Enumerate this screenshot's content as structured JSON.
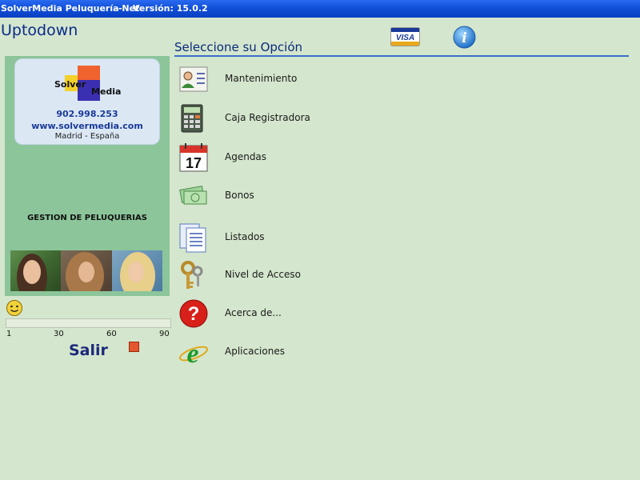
{
  "window": {
    "app_title": "SolverMedia Peluquería Net",
    "separator": "-",
    "version": "Versión: 15.0.2"
  },
  "brand": "Uptodown",
  "header": {
    "section_title": "Seleccione su Opción",
    "visa_icon": "visa-card-icon",
    "info_icon": "info-icon"
  },
  "company": {
    "logo_word1": "Solver",
    "logo_word2": "Media",
    "phone": "902.998.253",
    "website": "www.solvermedia.com",
    "location": "Madrid - España",
    "product": "GESTION DE PELUQUERIAS"
  },
  "status": {
    "ticks": [
      "1",
      "30",
      "60",
      "90"
    ],
    "progress_fraction": 0,
    "exit_label": "Salir"
  },
  "menu": [
    {
      "label": "Mantenimiento",
      "icon": "contact-card-icon"
    },
    {
      "label": "Caja Registradora",
      "icon": "calculator-icon"
    },
    {
      "label": "Agendas",
      "icon": "calendar-icon"
    },
    {
      "label": "Bonos",
      "icon": "money-icon"
    },
    {
      "label": "Listados",
      "icon": "documents-icon"
    },
    {
      "label": "Nivel de Acceso",
      "icon": "keys-icon"
    },
    {
      "label": "Acerca de...",
      "icon": "help-icon"
    },
    {
      "label": "Aplicaciones",
      "icon": "internet-explorer-icon"
    }
  ],
  "calendar_day": "17",
  "colors": {
    "background": "#d4e6cd",
    "panel": "#8cc59a",
    "titlebar": "#1150d8",
    "accent": "#3c6fc8"
  }
}
